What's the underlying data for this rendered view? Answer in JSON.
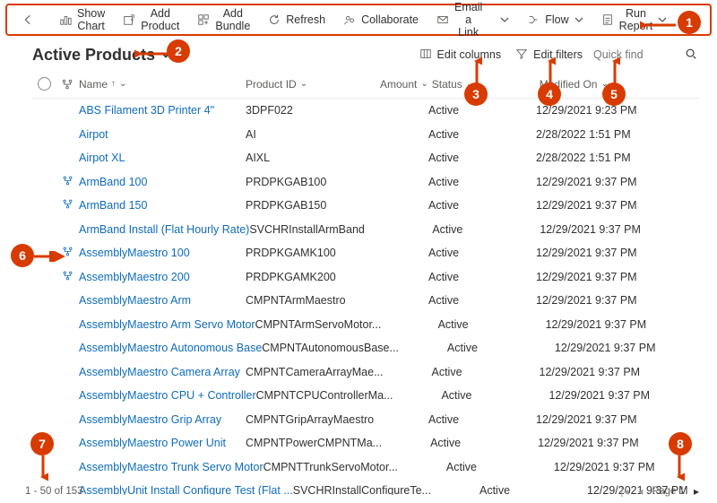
{
  "commandbar": {
    "back": "←",
    "show_chart": "Show Chart",
    "add_product": "Add Product",
    "add_bundle": "Add Bundle",
    "refresh": "Refresh",
    "collaborate": "Collaborate",
    "email_link": "Email a Link",
    "flow": "Flow",
    "run_report": "Run Report",
    "overflow": "⋮"
  },
  "view_title": "Active Products",
  "header_links": {
    "edit_columns": "Edit columns",
    "edit_filters": "Edit filters"
  },
  "search": {
    "placeholder": "Quick find"
  },
  "columns": {
    "name": "Name",
    "product_id": "Product ID",
    "amount": "Amount",
    "status": "Status",
    "modified_on": "Modified On"
  },
  "rows": [
    {
      "hier": false,
      "name": "ABS Filament 3D Printer 4\"",
      "product_id": "3DPF022",
      "status": "Active",
      "modified": "12/29/2021 9:23 PM"
    },
    {
      "hier": false,
      "name": "Airpot",
      "product_id": "AI",
      "status": "Active",
      "modified": "2/28/2022 1:51 PM"
    },
    {
      "hier": false,
      "name": "Airpot XL",
      "product_id": "AIXL",
      "status": "Active",
      "modified": "2/28/2022 1:51 PM"
    },
    {
      "hier": true,
      "name": "ArmBand 100",
      "product_id": "PRDPKGAB100",
      "status": "Active",
      "modified": "12/29/2021 9:37 PM"
    },
    {
      "hier": true,
      "name": "ArmBand 150",
      "product_id": "PRDPKGAB150",
      "status": "Active",
      "modified": "12/29/2021 9:37 PM"
    },
    {
      "hier": false,
      "name": "ArmBand Install (Flat Hourly Rate)",
      "product_id": "SVCHRInstallArmBand",
      "status": "Active",
      "modified": "12/29/2021 9:37 PM"
    },
    {
      "hier": true,
      "name": "AssemblyMaestro 100",
      "product_id": "PRDPKGAMK100",
      "status": "Active",
      "modified": "12/29/2021 9:37 PM"
    },
    {
      "hier": true,
      "name": "AssemblyMaestro 200",
      "product_id": "PRDPKGAMK200",
      "status": "Active",
      "modified": "12/29/2021 9:37 PM"
    },
    {
      "hier": false,
      "name": "AssemblyMaestro Arm",
      "product_id": "CMPNTArmMaestro",
      "status": "Active",
      "modified": "12/29/2021 9:37 PM"
    },
    {
      "hier": false,
      "name": "AssemblyMaestro Arm Servo Motor",
      "product_id": "CMPNTArmServoMotor...",
      "status": "Active",
      "modified": "12/29/2021 9:37 PM"
    },
    {
      "hier": false,
      "name": "AssemblyMaestro Autonomous Base",
      "product_id": "CMPNTAutonomousBase...",
      "status": "Active",
      "modified": "12/29/2021 9:37 PM"
    },
    {
      "hier": false,
      "name": "AssemblyMaestro Camera Array",
      "product_id": "CMPNTCameraArrayMae...",
      "status": "Active",
      "modified": "12/29/2021 9:37 PM"
    },
    {
      "hier": false,
      "name": "AssemblyMaestro CPU + Controller",
      "product_id": "CMPNTCPUControllerMa...",
      "status": "Active",
      "modified": "12/29/2021 9:37 PM"
    },
    {
      "hier": false,
      "name": "AssemblyMaestro Grip Array",
      "product_id": "CMPNTGripArrayMaestro",
      "status": "Active",
      "modified": "12/29/2021 9:37 PM"
    },
    {
      "hier": false,
      "name": "AssemblyMaestro Power Unit",
      "product_id": "CMPNTPowerCMPNTMa...",
      "status": "Active",
      "modified": "12/29/2021 9:37 PM"
    },
    {
      "hier": false,
      "name": "AssemblyMaestro Trunk Servo Motor",
      "product_id": "CMPNTTrunkServoMotor...",
      "status": "Active",
      "modified": "12/29/2021 9:37 PM"
    },
    {
      "hier": false,
      "name": "AssemblyUnit Install Configure Test (Flat ...",
      "product_id": "SVCHRInstallConfigureTe...",
      "status": "Active",
      "modified": "12/29/2021 9:37 PM"
    }
  ],
  "footer": {
    "range": "1 - 50 of 153",
    "page_label": "Page 1"
  },
  "callouts": {
    "c1": "1",
    "c2": "2",
    "c3": "3",
    "c4": "4",
    "c5": "5",
    "c6": "6",
    "c7": "7",
    "c8": "8"
  }
}
